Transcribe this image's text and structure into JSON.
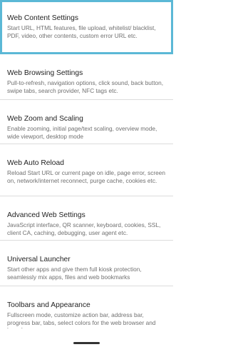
{
  "settings": {
    "items": [
      {
        "title": "Web Content Settings",
        "summary": "Start URL, HTML features, file upload, whitelist/ blacklist, PDF, video, other contents, custom error URL etc.",
        "selected": true
      },
      {
        "title": "Web Browsing Settings",
        "summary": "Pull-to-refresh, navigation options, click sound, back button, swipe tabs, search provider, NFC tags etc.",
        "selected": false
      },
      {
        "title": "Web Zoom and Scaling",
        "summary": "Enable zooming, initial page/text scaling, overview mode, wide viewport, desktop mode",
        "selected": false
      },
      {
        "title": "Web Auto Reload",
        "summary": "Reload Start URL or current page on idle, page error, screen on, network/internet reconnect, purge cache, cookies etc.",
        "selected": false
      },
      {
        "title": "Advanced Web Settings",
        "summary": "JavaScript interface, QR scanner, keyboard, cookies, SSL, client CA, caching, debugging, user agent etc.",
        "selected": false
      },
      {
        "title": "Universal Launcher",
        "summary": "Start other apps and give them full kiosk protection, seamlessly mix apps, files and web bookmarks",
        "selected": false
      },
      {
        "title": "Toolbars and Appearance",
        "summary": "Fullscreen mode, customize action bar, address bar, progress bar, tabs, select colors for the web browser and launcher",
        "selected": false
      }
    ]
  },
  "colors": {
    "selection_border": "#5bb8d6",
    "divider": "#dcdcdc",
    "title_text": "#1f1f1f",
    "summary_text": "#707070",
    "home_indicator": "#333333"
  }
}
